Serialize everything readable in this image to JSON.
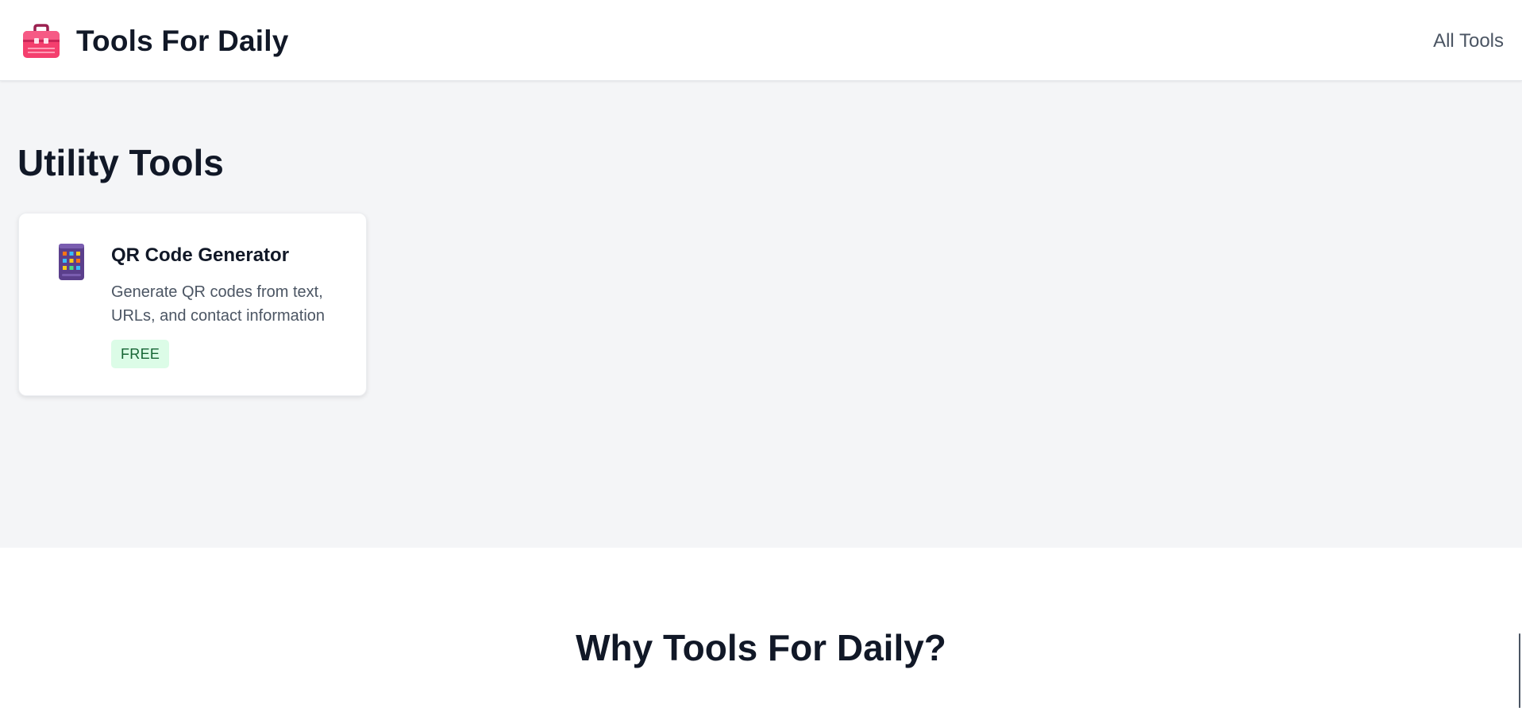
{
  "header": {
    "brand_title": "Tools For Daily",
    "brand_icon": "toolbox-icon",
    "nav": [
      {
        "label": "All Tools"
      }
    ]
  },
  "tools_section": {
    "title": "Utility Tools",
    "cards": [
      {
        "icon": "qr-grid-icon",
        "title": "QR Code Generator",
        "description": "Generate QR codes from text, URLs, and contact information",
        "badge": "FREE"
      }
    ]
  },
  "why_section": {
    "title": "Why Tools For Daily?"
  },
  "colors": {
    "brand_icon": "#f43f6e",
    "section_bg": "#f4f5f7",
    "badge_bg": "#dcfce7",
    "badge_text": "#166534",
    "heading": "#111827",
    "muted_text": "#4b5563"
  }
}
